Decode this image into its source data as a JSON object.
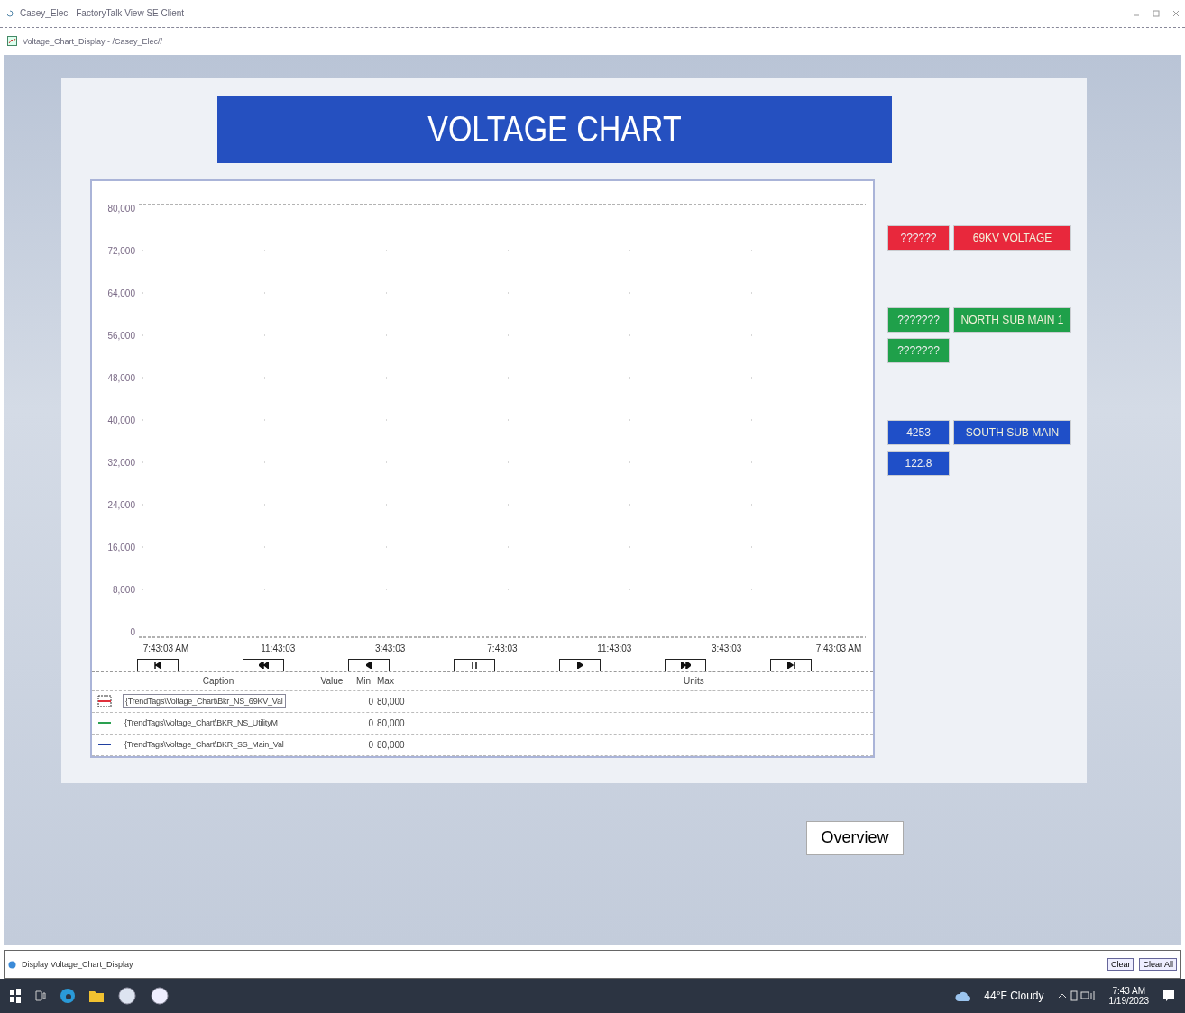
{
  "window": {
    "title": "Casey_Elec - FactoryTalk View SE Client"
  },
  "display_window": {
    "title": "Voltage_Chart_Display - /Casey_Elec//"
  },
  "header": {
    "title": "VOLTAGE CHART"
  },
  "chart": {
    "chart_data": {
      "type": "line",
      "grid": true,
      "ylim": [
        0,
        80000
      ],
      "yticks": [
        {
          "value": 80000,
          "label": "80,000"
        },
        {
          "value": 72000,
          "label": "72,000"
        },
        {
          "value": 64000,
          "label": "64,000"
        },
        {
          "value": 56000,
          "label": "56,000"
        },
        {
          "value": 48000,
          "label": "48,000"
        },
        {
          "value": 40000,
          "label": "40,000"
        },
        {
          "value": 32000,
          "label": "32,000"
        },
        {
          "value": 24000,
          "label": "24,000"
        },
        {
          "value": 16000,
          "label": "16,000"
        },
        {
          "value": 8000,
          "label": "8,000"
        },
        {
          "value": 0,
          "label": "0"
        }
      ],
      "categories": [
        "7:43:03 AM",
        "11:43:03",
        "3:43:03",
        "7:43:03",
        "11:43:03",
        "3:43:03",
        "7:43:03 AM"
      ]
    },
    "nav_buttons": [
      {
        "kind": "first"
      },
      {
        "kind": "rewind"
      },
      {
        "kind": "back"
      },
      {
        "kind": "pause"
      },
      {
        "kind": "play"
      },
      {
        "kind": "forward"
      },
      {
        "kind": "last"
      }
    ],
    "legend": {
      "columns": {
        "caption": "Caption",
        "value": "Value",
        "min": "Min",
        "max": "Max",
        "units": "Units"
      },
      "rows": [
        {
          "caption": "{TrendTags\\Voltage_Chart\\Bkr_NS_69KV_Val",
          "min": "0",
          "max": "80,000",
          "color": "#e0303c",
          "selected": true
        },
        {
          "caption": "{TrendTags\\Voltage_Chart\\BKR_NS_UtilityM",
          "min": "0",
          "max": "80,000",
          "color": "#2aa050",
          "selected": false
        },
        {
          "caption": "{TrendTags\\Voltage_Chart\\BKR_SS_Main_Val",
          "min": "0",
          "max": "80,000",
          "color": "#2040a0",
          "selected": false
        }
      ]
    }
  },
  "indicator_groups": [
    {
      "rows": [
        {
          "value": "??????",
          "label": "69KV VOLTAGE",
          "color": "#e8283c"
        }
      ]
    },
    {
      "rows": [
        {
          "value": "???????",
          "label": "NORTH SUB MAIN 1",
          "color": "#1fa04a"
        },
        {
          "value": "???????",
          "color": "#1fa04a"
        }
      ]
    },
    {
      "rows": [
        {
          "value": "4253",
          "label": "SOUTH SUB MAIN",
          "color": "#1f4fc8"
        },
        {
          "value": "122.8",
          "color": "#1f4fc8"
        }
      ]
    }
  ],
  "overview_button": {
    "label": "Overview"
  },
  "status_bar": {
    "text": "Display Voltage_Chart_Display",
    "buttons": [
      "Clear",
      "Clear All"
    ]
  },
  "taskbar": {
    "weather": "44°F Cloudy",
    "time": "7:43 AM",
    "date": "1/19/2023"
  }
}
